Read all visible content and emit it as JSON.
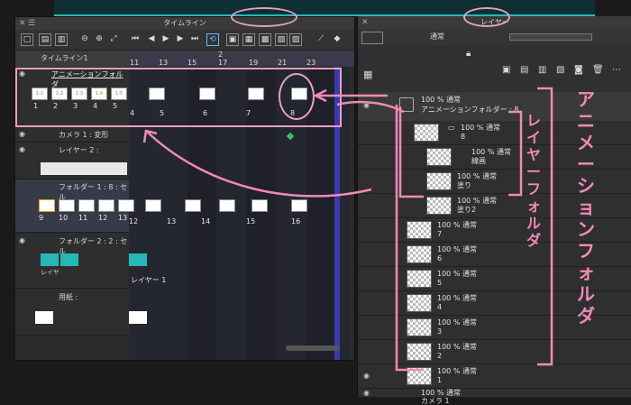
{
  "timeline": {
    "panel_title": "タイムライン",
    "name": "タイムライン1",
    "ruler": [
      "11",
      "13",
      "15",
      "17",
      "19",
      "21",
      "23"
    ],
    "ruler_marker": "2",
    "rows": {
      "anim_folder": "アニメーションフォルダ",
      "camera": "カメラ 1 : 変形",
      "layer2": "レイヤー 2 :",
      "folder1": "フォルダー 1 : 8 : セル",
      "folder2": "フォルダー 2 : 2 : セル",
      "paper": "用紙 :",
      "layer1_label": "レイヤー 1",
      "layer_short": "レイヤ"
    },
    "anim_thumbs": [
      "1-1",
      "1-2",
      "1-3",
      "1-4",
      "1-5"
    ],
    "anim_nums": [
      "1",
      "2",
      "3",
      "4",
      "5"
    ],
    "anim_frame_nums": [
      "4",
      "5",
      "6",
      "7",
      "8"
    ],
    "folder1_nums": [
      "9",
      "10",
      "11",
      "12",
      "13"
    ],
    "folder1_frame_nums": [
      "12",
      "13",
      "14",
      "15",
      "16"
    ]
  },
  "layers": {
    "panel_title": "レイヤー",
    "blend": "通常",
    "items": [
      {
        "op": "100 % 通常",
        "name": "アニメーションフォルダー : 8"
      },
      {
        "op": "100 % 通常",
        "name": "8"
      },
      {
        "op": "100 % 通常",
        "name": "線画"
      },
      {
        "op": "100 % 通常",
        "name": "塗り"
      },
      {
        "op": "100 % 通常",
        "name": "塗り2"
      },
      {
        "op": "100 % 通常",
        "name": "7"
      },
      {
        "op": "100 % 通常",
        "name": "6"
      },
      {
        "op": "100 % 通常",
        "name": "5"
      },
      {
        "op": "100 % 通常",
        "name": "4"
      },
      {
        "op": "100 % 通常",
        "name": "3"
      },
      {
        "op": "100 % 通常",
        "name": "2"
      },
      {
        "op": "100 % 通常",
        "name": "1"
      },
      {
        "op": "100 % 通常",
        "name": "カメラ 1"
      }
    ]
  },
  "annotations": {
    "anim_folder": "アニメーションフォルダ",
    "layer_folder": "レイヤーフォルダ"
  },
  "colors": {
    "accent": "#26b8b8",
    "annotation": "#f08ab8",
    "marker": "#3fbf5a"
  }
}
